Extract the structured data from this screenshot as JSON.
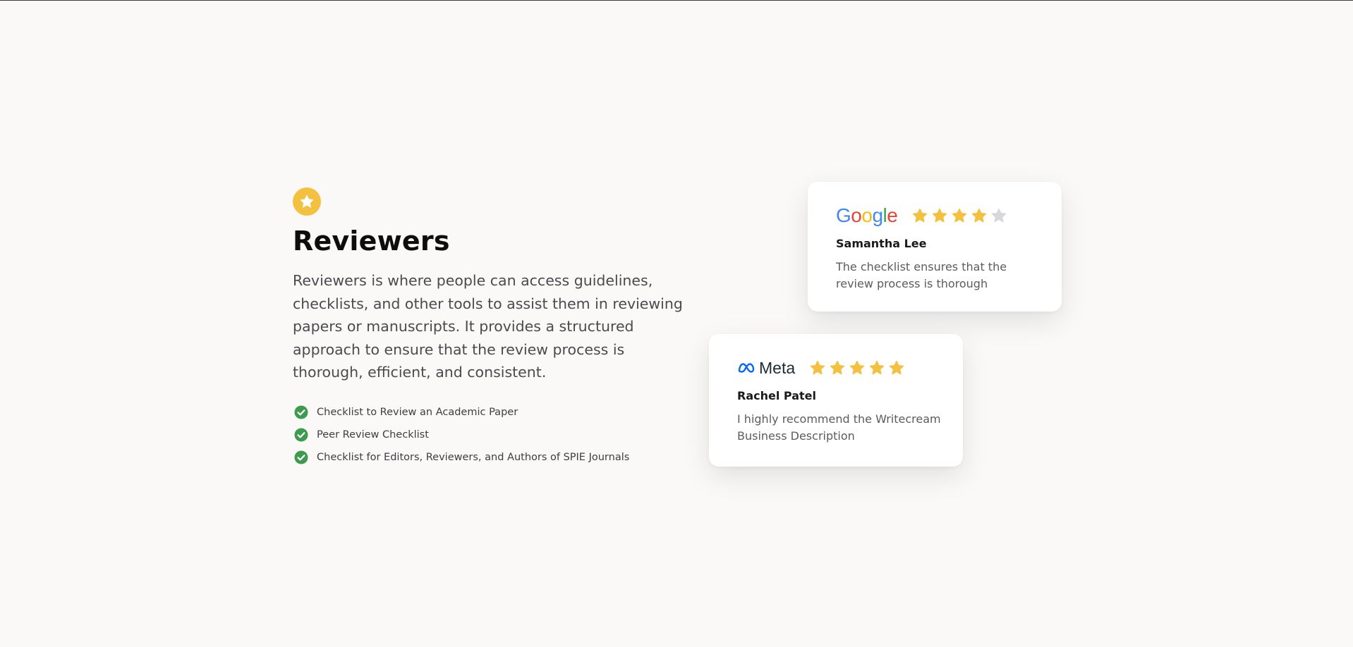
{
  "section": {
    "icon": "star-icon",
    "title": "Reviewers",
    "description": "Reviewers is where people can access guidelines, checklists, and other tools to assist them in reviewing papers or manuscripts. It provides a structured approach to ensure that the review process is thorough, efficient, and consistent.",
    "checklist": [
      "Checklist to Review an Academic Paper",
      "Peer Review Checklist",
      "Checklist for Editors, Reviewers, and Authors of SPIE Journals"
    ]
  },
  "reviews": [
    {
      "brand": "Google",
      "rating": 4,
      "max_rating": 5,
      "name": "Samantha Lee",
      "text": "The checklist ensures that the review process is thorough"
    },
    {
      "brand": "Meta",
      "rating": 5,
      "max_rating": 5,
      "name": "Rachel Patel",
      "text": "I highly recommend the Writecream Business Description"
    }
  ],
  "colors": {
    "background": "#faf9f7",
    "accent_yellow": "#f4c040",
    "star_filled": "#f4c040",
    "star_empty": "#d8d8dc",
    "check_green": "#3d9a4f",
    "google_blue": "#4285f4",
    "google_red": "#ea4335",
    "google_yellow": "#fbbc05",
    "google_green": "#34a853",
    "meta_blue": "#0866ff"
  }
}
